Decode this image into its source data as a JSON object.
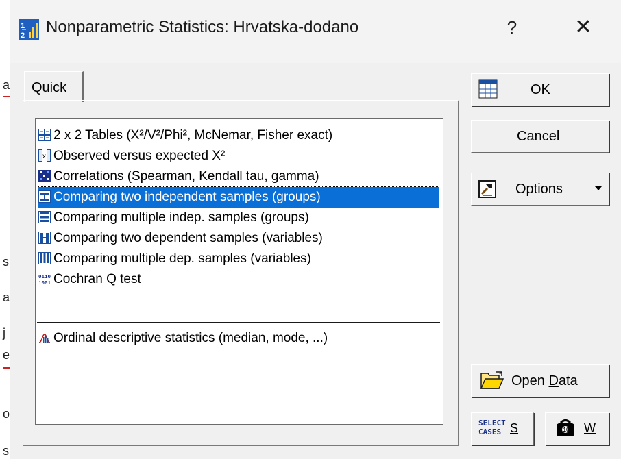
{
  "window": {
    "title": "Nonparametric Statistics: Hrvatska-dodano",
    "help_label": "?",
    "close_label": "✕"
  },
  "tabs": [
    {
      "label": "Quick"
    }
  ],
  "analysis_list": {
    "items": [
      {
        "label": "2 x 2 Tables (X²/V²/Phi², McNemar, Fisher exact)",
        "icon": "table-grid-icon"
      },
      {
        "label": "Observed versus expected X²",
        "icon": "observed-expected-icon"
      },
      {
        "label": "Correlations (Spearman, Kendall tau, gamma)",
        "icon": "correlation-matrix-icon"
      },
      {
        "label": "Comparing two independent samples (groups)",
        "icon": "two-groups-icon",
        "selected": true
      },
      {
        "label": "Comparing multiple indep. samples (groups)",
        "icon": "multiple-groups-icon"
      },
      {
        "label": "Comparing two dependent samples (variables)",
        "icon": "two-dependent-icon"
      },
      {
        "label": "Comparing multiple dep. samples (variables)",
        "icon": "multiple-dependent-icon"
      },
      {
        "label": "Cochran Q test",
        "icon": "binary-data-icon"
      },
      {
        "label": "Ordinal descriptive statistics (median, mode, ...)",
        "icon": "distribution-chart-icon"
      }
    ]
  },
  "buttons": {
    "ok": "OK",
    "cancel": "Cancel",
    "options": "Options",
    "open_data_prefix": "Open ",
    "open_data_underlined": "D",
    "open_data_suffix": "ata",
    "select_cases_line1": "SELECT",
    "select_cases_line2": "CASES",
    "select_cases_key": "S",
    "weights_key": "W"
  },
  "colors": {
    "selection": "#0a6fd6",
    "dialog_bg": "#f0f0f0"
  }
}
